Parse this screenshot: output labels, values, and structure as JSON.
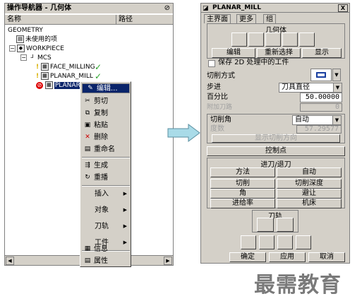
{
  "navigator": {
    "title": "操作导航器 - 几何体",
    "columns": [
      "名称",
      "路径"
    ],
    "tree": {
      "root": "GEOMETRY",
      "unused": "未使用的项",
      "workpiece": "WORKPIECE",
      "mcs": "MCS",
      "op1": "FACE_MILLING",
      "op2": "PLANAR_MILL",
      "op3": "PLANAR_"
    }
  },
  "context_menu": {
    "items": [
      {
        "label": "编辑...",
        "icon": "edit-icon"
      },
      {
        "label": "剪切",
        "icon": "cut-icon"
      },
      {
        "label": "复制",
        "icon": "copy-icon"
      },
      {
        "label": "粘贴",
        "icon": "paste-icon"
      },
      {
        "label": "删除",
        "icon": "delete-icon"
      },
      {
        "label": "重命名",
        "icon": "rename-icon"
      },
      {
        "label": "生成",
        "icon": "generate-icon"
      },
      {
        "label": "重播",
        "icon": "replay-icon"
      },
      {
        "label": "插入",
        "icon": ""
      },
      {
        "label": "对象",
        "icon": ""
      },
      {
        "label": "刀轨",
        "icon": ""
      },
      {
        "label": "工件",
        "icon": ""
      },
      {
        "label": "信息",
        "icon": "info-icon"
      },
      {
        "label": "属性",
        "icon": "properties-icon"
      }
    ]
  },
  "dialog": {
    "title": "PLANAR_MILL",
    "close": "X",
    "tabs": [
      "主界面",
      "更多",
      "组"
    ],
    "geometry_label": "几何体",
    "geom_buttons": {
      "edit": "编辑",
      "reselect": "重新选择",
      "display": "显示"
    },
    "keep_2d": "保存 2D 处理中的工件",
    "cut_method_label": "切削方式",
    "stepover_label": "步进",
    "stepover_value": "刀具直径",
    "percent_label": "百分比",
    "percent_value": "50.00000",
    "extra_passes_label": "附加刀路",
    "extra_passes_value": "0",
    "cut_angle_label": "切削角",
    "cut_angle_value": "自动",
    "degrees_label": "度数",
    "degrees_value": "57.29577",
    "show_cut_dir": "显示切削方向",
    "control_points": "控制点",
    "engage_retract": "进刀/退刀",
    "method": "方法",
    "auto": "自动",
    "cutting": "切削",
    "cut_depth": "切削深度",
    "corner": "角",
    "avoidance": "避让",
    "feedrates": "进给率",
    "machine": "机床",
    "toolpath_label": "刀轨",
    "ok": "确定",
    "apply": "应用",
    "cancel": "取消"
  },
  "watermark": "最需教育",
  "colors": {
    "selection": "#0a246a",
    "check": "#2aa42a",
    "arrow": "#a9dbe8"
  }
}
